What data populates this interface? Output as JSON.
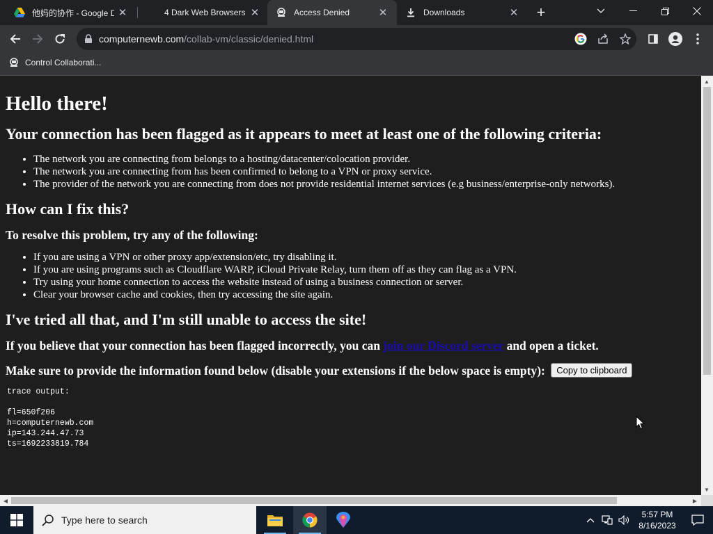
{
  "browser": {
    "tabs": [
      {
        "title": "他妈的协作 - Google D",
        "active": false
      },
      {
        "title": "4 Dark Web Browsers i",
        "active": false
      },
      {
        "title": "Access Denied",
        "active": true
      },
      {
        "title": "Downloads",
        "active": false
      }
    ],
    "url_host": "computernewb.com",
    "url_path": "/collab-vm/classic/denied.html",
    "bookmark": "Control Collaborati..."
  },
  "page": {
    "h1": "Hello there!",
    "h2_criteria": "Your connection has been flagged as it appears to meet at least one of the following criteria:",
    "criteria": [
      "The network you are connecting from belongs to a hosting/datacenter/colocation provider.",
      "The network you are connecting from has been confirmed to belong to a VPN or proxy service.",
      "The provider of the network you are connecting from does not provide residential internet services (e.g business/enterprise-only networks)."
    ],
    "h2_fix": "How can I fix this?",
    "h3_resolve": "To resolve this problem, try any of the following:",
    "fixes": [
      "If you are using a VPN or other proxy app/extension/etc, try disabling it.",
      "If you are using programs such as Cloudflare WARP, iCloud Private Relay, turn them off as they can flag as a VPN.",
      "Try using your home connection to access the website instead of using a business connection or server.",
      "Clear your browser cache and cookies, then try accessing the site again."
    ],
    "h2_tried": "I've tried all that, and I'm still unable to access the site!",
    "h3_flagged_before": "If you believe that your connection has been flagged incorrectly, you can ",
    "h3_flagged_link": "join our Discord server",
    "h3_flagged_after": " and open a ticket.",
    "h3_info": "Make sure to provide the information found below (disable your extensions if the below space is empty):",
    "copy_button": "Copy to clipboard",
    "trace_label": "trace output:",
    "trace_lines": [
      "fl=650f206",
      "h=computernewb.com",
      "ip=143.244.47.73",
      "ts=1692233819.784"
    ]
  },
  "taskbar": {
    "search_placeholder": "Type here to search",
    "time": "5:57 PM",
    "date": "8/16/2023"
  }
}
